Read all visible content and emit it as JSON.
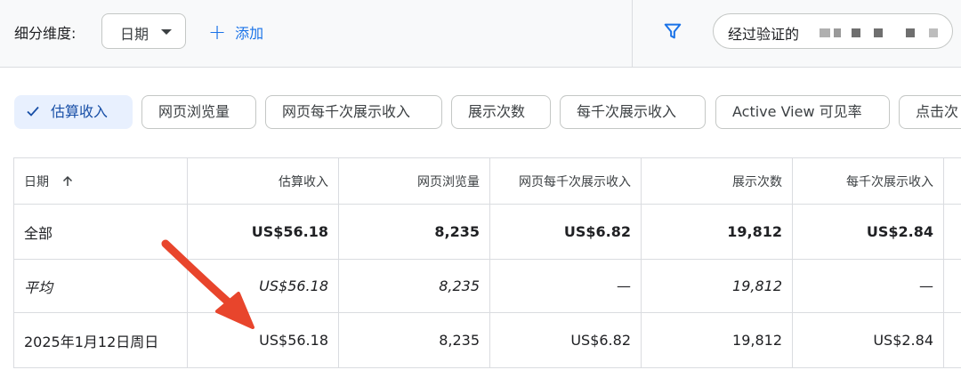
{
  "toolbar": {
    "dimension_label": "细分维度:",
    "dimension_value": "日期",
    "add_label": "添加",
    "filter_text": "经过验证的"
  },
  "metric_chips": [
    {
      "label": "估算收入",
      "selected": true
    },
    {
      "label": "网页浏览量",
      "selected": false
    },
    {
      "label": "网页每千次展示收入",
      "selected": false
    },
    {
      "label": "展示次数",
      "selected": false
    },
    {
      "label": "每千次展示收入",
      "selected": false
    },
    {
      "label": "Active View 可见率",
      "selected": false
    },
    {
      "label": "点击次",
      "selected": false
    }
  ],
  "table": {
    "headers": [
      "日期",
      "估算收入",
      "网页浏览量",
      "网页每千次展示收入",
      "展示次数",
      "每千次展示收入"
    ],
    "rows": [
      {
        "label": "全部",
        "cells": [
          "US$56.18",
          "8,235",
          "US$6.82",
          "19,812",
          "US$2.84"
        ]
      },
      {
        "label": "平均",
        "cells": [
          "US$56.18",
          "8,235",
          "—",
          "19,812",
          "—"
        ]
      },
      {
        "label": "2025年1月12日周日",
        "cells": [
          "US$56.18",
          "8,235",
          "US$6.82",
          "19,812",
          "US$2.84"
        ]
      }
    ]
  },
  "colors": {
    "accent": "#1a73e8",
    "selected_chip_bg": "#e8f0fe",
    "annotation_arrow": "#e8452c"
  },
  "icons": {
    "filter": "filter-icon",
    "sort": "arrow-up-icon",
    "check": "check-icon",
    "add": "plus-icon",
    "dropdown": "caret-down-icon"
  }
}
